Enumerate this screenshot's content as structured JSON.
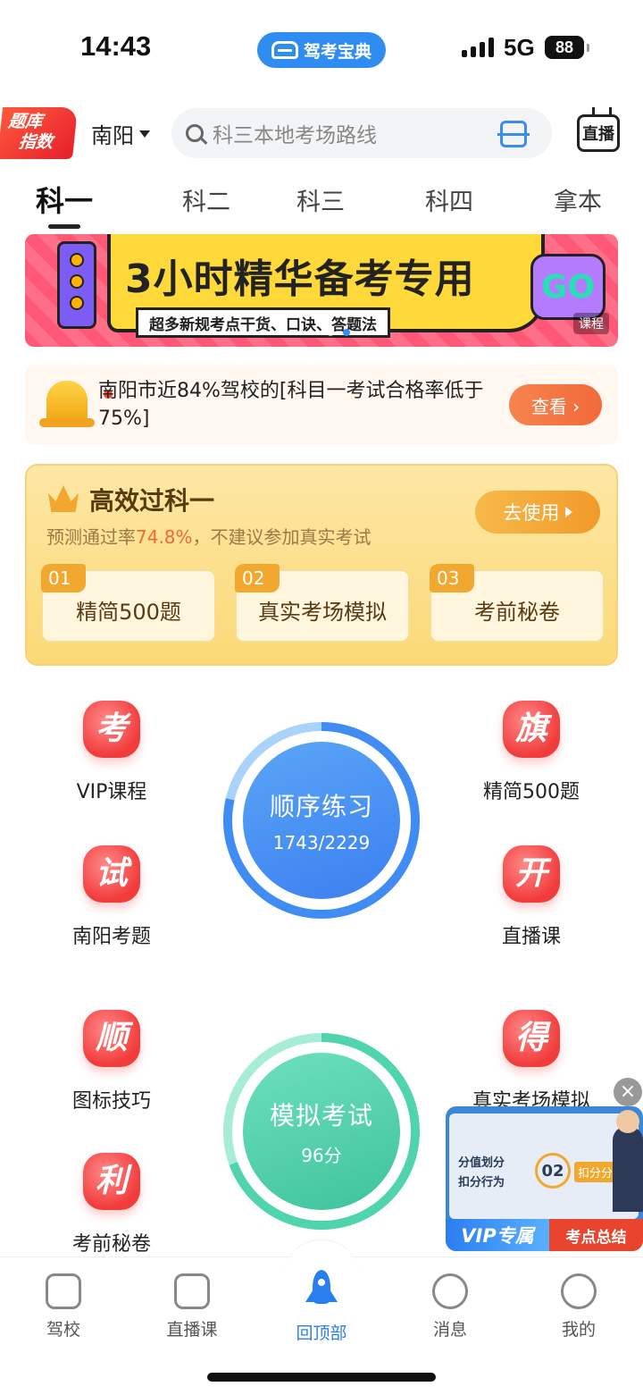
{
  "status_bar": {
    "time": "14:43",
    "app_name": "驾考宝典",
    "network": "5G",
    "battery": "88"
  },
  "header": {
    "badge_line1": "题库",
    "badge_line2": "指数",
    "city": "南阳",
    "search_placeholder": "科三本地考场路线",
    "live_label": "直播"
  },
  "tabs": [
    {
      "label": "科一",
      "active": true
    },
    {
      "label": "科二",
      "active": false
    },
    {
      "label": "科三",
      "active": false
    },
    {
      "label": "科四",
      "active": false
    },
    {
      "label": "拿本",
      "active": false
    }
  ],
  "banner": {
    "headline": "3小时精华备考专用",
    "sub": "超多新规考点干货、口诀、答题法",
    "go": "GO",
    "tag": "课程"
  },
  "notice": {
    "text": "南阳市近84%驾校的[科目一考试合格率低于75%]",
    "button": "查看 ›"
  },
  "efficient": {
    "title": "高效过科一",
    "desc_prefix": "预测通过率",
    "pass_rate": "74.8%",
    "desc_suffix": "，不建议参加真实考试",
    "use_button": "去使用",
    "items": [
      {
        "num": "01",
        "label": "精简500题"
      },
      {
        "num": "02",
        "label": "真实考场模拟"
      },
      {
        "num": "03",
        "label": "考前秘卷"
      }
    ]
  },
  "grid": {
    "left": [
      {
        "glyph": "考",
        "label": "VIP课程"
      },
      {
        "glyph": "试",
        "label": "南阳考题"
      },
      {
        "glyph": "顺",
        "label": "图标技巧"
      },
      {
        "glyph": "利",
        "label": "考前秘卷"
      }
    ],
    "right": [
      {
        "glyph": "旗",
        "label": "精简500题"
      },
      {
        "glyph": "开",
        "label": "直播课"
      },
      {
        "glyph": "得",
        "label": "真实考场模拟"
      }
    ]
  },
  "practice": {
    "title": "顺序练习",
    "progress": "1743/2229",
    "done": 1743,
    "total": 2229
  },
  "mock_exam": {
    "title": "模拟考试",
    "score": "96分"
  },
  "float_video": {
    "line1": "分值划分",
    "line2": "扣分行为",
    "num": "02",
    "keyword": "扣分分值",
    "vip": "VIP专属",
    "summary": "考点总结",
    "close": "×"
  },
  "bottom_nav": [
    {
      "label": "驾校",
      "icon": "driving-school-icon",
      "active": false
    },
    {
      "label": "直播课",
      "icon": "tv-icon",
      "active": false
    },
    {
      "label": "回顶部",
      "icon": "rocket-icon",
      "active": true
    },
    {
      "label": "消息",
      "icon": "chat-icon",
      "active": false
    },
    {
      "label": "我的",
      "icon": "profile-icon",
      "active": false
    }
  ],
  "colors": {
    "accent": "#2a7ef0",
    "red": "#f23b3b",
    "gold": "#f2a72e",
    "green": "#3ec39c"
  }
}
